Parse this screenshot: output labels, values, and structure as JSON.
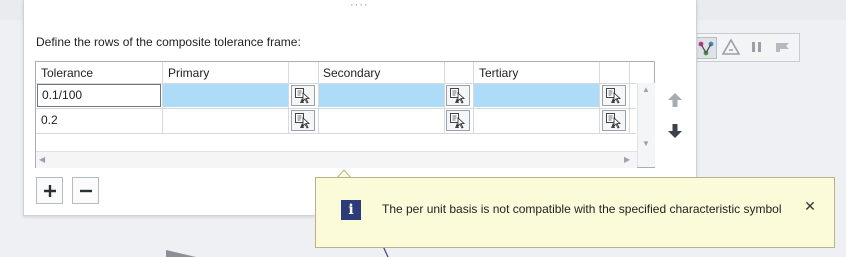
{
  "dialog": {
    "grip": "····",
    "instruction": "Define the rows of the composite tolerance frame:",
    "columns": [
      "Tolerance",
      "Primary",
      "Secondary",
      "Tertiary"
    ],
    "rows": [
      {
        "tolerance": "0.1/100",
        "primary": "",
        "secondary": "",
        "tertiary": "",
        "selected": true
      },
      {
        "tolerance": "0.2",
        "primary": "",
        "secondary": "",
        "tertiary": "",
        "selected": false
      }
    ]
  },
  "tooltip": {
    "icon": "info-icon",
    "icon_glyph": "i",
    "message": "The per unit basis is not compatible with the specified characteristic symbol",
    "close": "✕"
  },
  "colors": {
    "selection": "#aedcf8",
    "tooltip_bg": "#fbfbd9",
    "info_icon": "#2d3c78"
  }
}
